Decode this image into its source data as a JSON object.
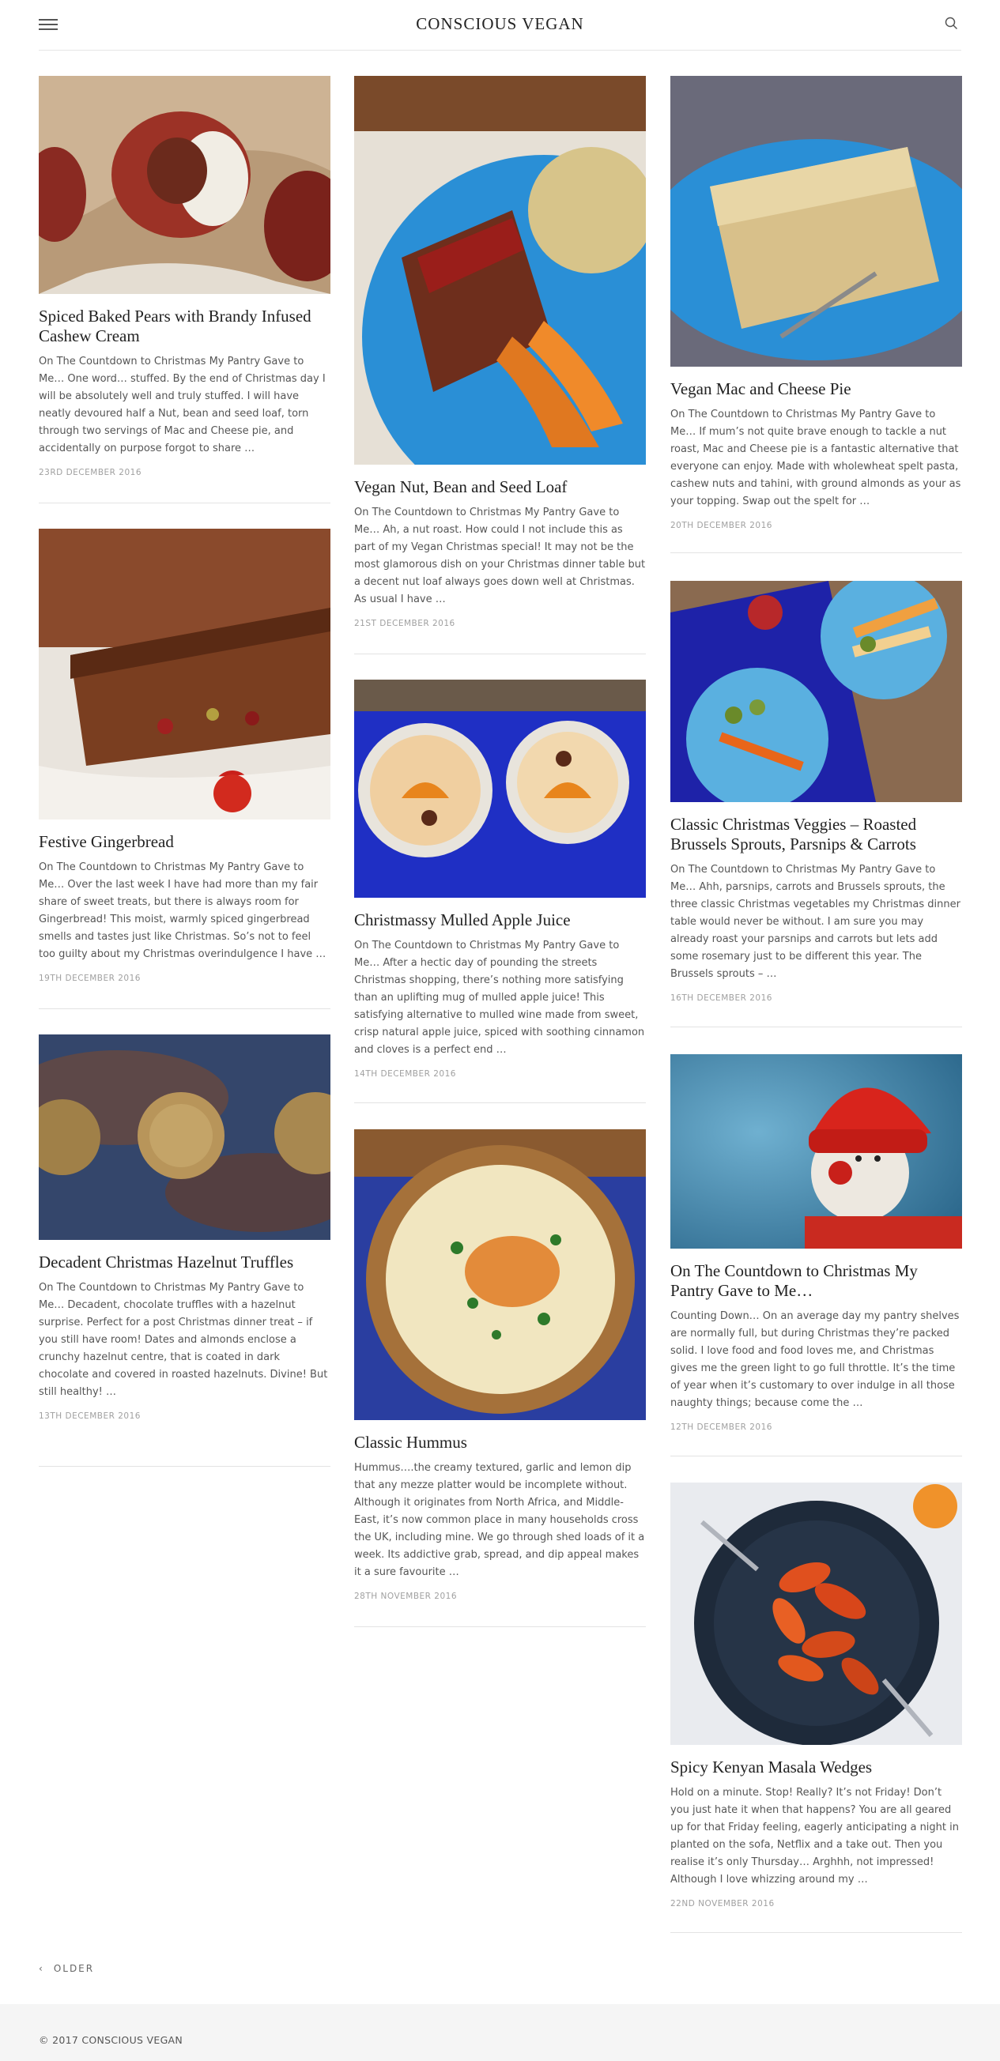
{
  "site": {
    "title": "CONSCIOUS VEGAN"
  },
  "header": {
    "menu_icon": "hamburger-menu-icon",
    "search_icon": "search-icon"
  },
  "posts": [
    {
      "title": "Spiced Baked Pears with Brandy Infused Cashew Cream",
      "excerpt": "On The Countdown to Christmas My Pantry Gave to Me… One word… stuffed. By the end of Christmas day I will be absolutely well and truly stuffed. I will have neatly devoured half a Nut, bean and seed loaf, torn through two servings of Mac and Cheese pie, and accidentally on purpose forgot to share …",
      "date": "23RD DECEMBER 2016"
    },
    {
      "title": "Vegan Nut, Bean and Seed Loaf",
      "excerpt": "On The Countdown to Christmas My Pantry Gave to Me… Ah, a nut roast. How could I not include this as part of my Vegan Christmas special! It may not be the most glamorous dish on your Christmas dinner table but a decent nut loaf always goes down well at Christmas. As usual I have …",
      "date": "21ST DECEMBER 2016"
    },
    {
      "title": "Vegan Mac and Cheese Pie",
      "excerpt": "On The Countdown to Christmas My Pantry Gave to Me… If mum’s not quite brave enough to tackle a nut roast, Mac and Cheese pie is a fantastic alternative that everyone can enjoy. Made with wholewheat spelt pasta, cashew nuts and tahini, with ground almonds as your as your topping. Swap out the spelt for …",
      "date": "20TH DECEMBER 2016"
    },
    {
      "title": "Festive Gingerbread",
      "excerpt": "On The Countdown to Christmas My Pantry Gave to Me… Over the last week I have had more than my fair share of sweet treats, but there is always room for Gingerbread! This moist, warmly spiced gingerbread smells and tastes just like Christmas. So’s not to feel too guilty about my Christmas overindulgence I have …",
      "date": "19TH DECEMBER 2016"
    },
    {
      "title": "Classic Christmas Veggies – Roasted Brussels Sprouts, Parsnips & Carrots",
      "excerpt": "On The Countdown to Christmas My Pantry Gave to Me… Ahh, parsnips, carrots and Brussels sprouts, the three classic Christmas vegetables my Christmas dinner table would never be without. I am sure you may already roast your parsnips and carrots but lets add some rosemary just to be different this year. The Brussels sprouts – …",
      "date": "16TH DECEMBER 2016"
    },
    {
      "title": "Christmassy Mulled Apple Juice",
      "excerpt": "On The Countdown to Christmas My Pantry Gave to Me… After a hectic day of pounding the streets Christmas shopping, there’s nothing more satisfying than an uplifting mug of mulled apple juice! This satisfying alternative to mulled wine made from sweet, crisp natural apple juice, spiced with soothing cinnamon and cloves is a perfect end …",
      "date": "14TH DECEMBER 2016"
    },
    {
      "title": "Decadent Christmas Hazelnut Truffles",
      "excerpt": "On The Countdown to Christmas My Pantry Gave to Me… Decadent, chocolate truffles with a hazelnut surprise. Perfect for a post Christmas dinner treat – if you still have room! Dates and almonds enclose a crunchy hazelnut centre, that is coated in dark chocolate and covered in roasted hazelnuts.  Divine! But still healthy! …",
      "date": "13TH DECEMBER 2016"
    },
    {
      "title": "On The Countdown to Christmas My Pantry Gave to Me…",
      "excerpt": "Counting Down… On an average day my pantry shelves are normally full, but during Christmas they’re packed solid. I love food and food loves me, and Christmas gives me the green light to go full throttle. It’s the time of year when it’s customary to over indulge in all those naughty things; because come the …",
      "date": "12TH DECEMBER 2016"
    },
    {
      "title": "Classic Hummus",
      "excerpt": "Hummus….the creamy textured, garlic and lemon dip that any mezze platter would be incomplete without. Although it originates from North Africa, and Middle-East, it’s now common place in many households cross the UK, including mine. We go through shed loads of it a week. Its addictive grab, spread, and dip appeal makes it a sure favourite …",
      "date": "28TH NOVEMBER 2016"
    },
    {
      "title": "Spicy Kenyan Masala Wedges",
      "excerpt": "Hold on a minute. Stop! Really? It’s not Friday! Don’t you just hate it when that happens? You are all geared up for that Friday feeling, eagerly anticipating a night in planted on the sofa, Netflix and a take out. Then you realise it’s only Thursday… Arghhh, not impressed! Although I love whizzing around my …",
      "date": "22ND NOVEMBER 2016"
    }
  ],
  "pagination": {
    "older_label": "OLDER"
  },
  "footer": {
    "copyright": "© 2017 CONSCIOUS VEGAN"
  },
  "colors": {
    "text": "#333333",
    "muted": "#a0a0a0",
    "footer_bg": "#f5f5f5",
    "plate_blue": "#2a8fd6"
  }
}
